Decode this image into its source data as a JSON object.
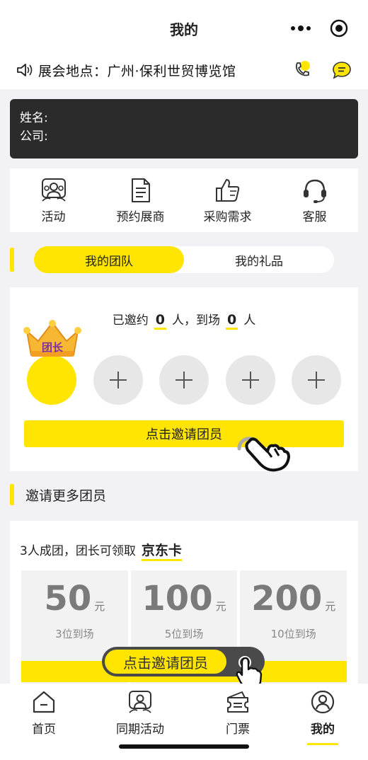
{
  "header": {
    "title": "我的"
  },
  "venue": {
    "text": "展会地点：广州·保利世贸博览馆"
  },
  "profile": {
    "name_label": "姓名:",
    "company_label": "公司:"
  },
  "quick_links": [
    {
      "label": "活动",
      "icon": "group-icon"
    },
    {
      "label": "预约展商",
      "icon": "document-icon"
    },
    {
      "label": "采购需求",
      "icon": "thumbs-up-icon"
    },
    {
      "label": "客服",
      "icon": "headset-icon"
    }
  ],
  "tabs": [
    {
      "label": "我的团队",
      "active": true
    },
    {
      "label": "我的礼品",
      "active": false
    }
  ],
  "team": {
    "invited_prefix": "已邀约",
    "invited_count": "0",
    "invited_unit": "人，到场",
    "arrived_count": "0",
    "arrived_unit": "人",
    "leader_badge": "团长",
    "invite_button": "点击邀请团员"
  },
  "more": {
    "title": "邀请更多团员"
  },
  "reward": {
    "line": "3人成团，团长可领取",
    "card": "京东卡",
    "tickets": [
      {
        "amount": "50",
        "unit": "元",
        "condition": "3位到场"
      },
      {
        "amount": "100",
        "unit": "元",
        "condition": "5位到场"
      },
      {
        "amount": "200",
        "unit": "元",
        "condition": "10位到场"
      }
    ],
    "float_button": "点击邀请团员"
  },
  "nav": [
    {
      "label": "首页",
      "icon": "home-icon"
    },
    {
      "label": "同期活动",
      "icon": "group-icon"
    },
    {
      "label": "门票",
      "icon": "ticket-icon"
    },
    {
      "label": "我的",
      "icon": "profile-icon",
      "active": true
    }
  ],
  "colors": {
    "accent": "#ffe500",
    "dark": "#2b2b2b"
  }
}
